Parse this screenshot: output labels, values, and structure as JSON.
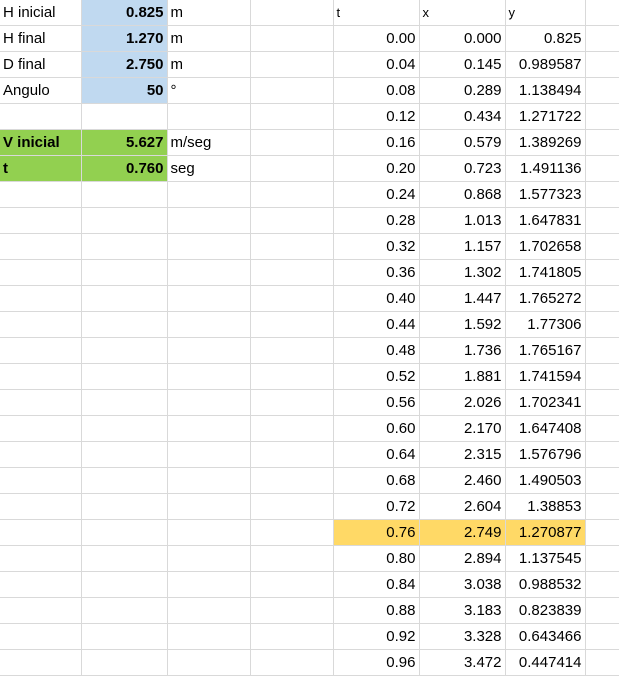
{
  "params": [
    {
      "label": "H inicial",
      "value": "0.825",
      "unit": "m"
    },
    {
      "label": "H final",
      "value": "1.270",
      "unit": "m"
    },
    {
      "label": "D final",
      "value": "2.750",
      "unit": "m"
    },
    {
      "label": "Angulo",
      "value": "50",
      "unit": "°"
    }
  ],
  "results": [
    {
      "label": "V inicial",
      "value": "5.627",
      "unit": "m/seg"
    },
    {
      "label": "t",
      "value": "0.760",
      "unit": "seg"
    }
  ],
  "headers": {
    "t": "t",
    "x": "x",
    "y": "y"
  },
  "rows": [
    {
      "t": "0.00",
      "x": "0.000",
      "y": "0.825"
    },
    {
      "t": "0.04",
      "x": "0.145",
      "y": "0.989587"
    },
    {
      "t": "0.08",
      "x": "0.289",
      "y": "1.138494"
    },
    {
      "t": "0.12",
      "x": "0.434",
      "y": "1.271722"
    },
    {
      "t": "0.16",
      "x": "0.579",
      "y": "1.389269"
    },
    {
      "t": "0.20",
      "x": "0.723",
      "y": "1.491136"
    },
    {
      "t": "0.24",
      "x": "0.868",
      "y": "1.577323"
    },
    {
      "t": "0.28",
      "x": "1.013",
      "y": "1.647831"
    },
    {
      "t": "0.32",
      "x": "1.157",
      "y": "1.702658"
    },
    {
      "t": "0.36",
      "x": "1.302",
      "y": "1.741805"
    },
    {
      "t": "0.40",
      "x": "1.447",
      "y": "1.765272"
    },
    {
      "t": "0.44",
      "x": "1.592",
      "y": "1.77306"
    },
    {
      "t": "0.48",
      "x": "1.736",
      "y": "1.765167"
    },
    {
      "t": "0.52",
      "x": "1.881",
      "y": "1.741594"
    },
    {
      "t": "0.56",
      "x": "2.026",
      "y": "1.702341"
    },
    {
      "t": "0.60",
      "x": "2.170",
      "y": "1.647408"
    },
    {
      "t": "0.64",
      "x": "2.315",
      "y": "1.576796"
    },
    {
      "t": "0.68",
      "x": "2.460",
      "y": "1.490503"
    },
    {
      "t": "0.72",
      "x": "2.604",
      "y": "1.38853"
    },
    {
      "t": "0.76",
      "x": "2.749",
      "y": "1.270877"
    },
    {
      "t": "0.80",
      "x": "2.894",
      "y": "1.137545"
    },
    {
      "t": "0.84",
      "x": "3.038",
      "y": "0.988532"
    },
    {
      "t": "0.88",
      "x": "3.183",
      "y": "0.823839"
    },
    {
      "t": "0.92",
      "x": "3.328",
      "y": "0.643466"
    },
    {
      "t": "0.96",
      "x": "3.472",
      "y": "0.447414"
    }
  ],
  "highlight_row": 19,
  "colors": {
    "input_fill": "#c0d9f0",
    "result_fill": "#92d050",
    "highlight_fill": "#ffd966",
    "gridline": "#d9d9d9"
  }
}
